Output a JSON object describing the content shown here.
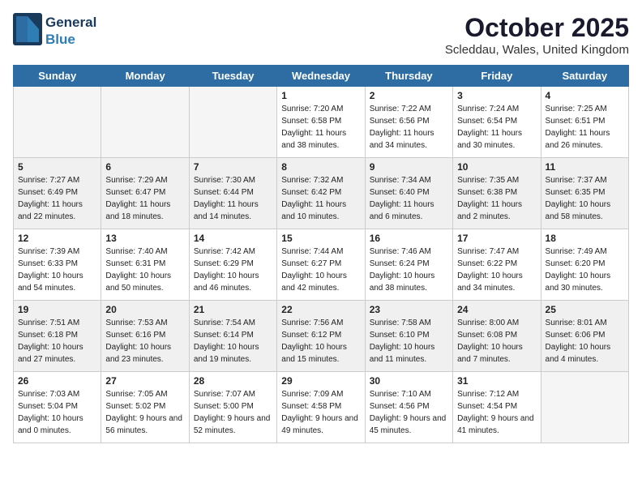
{
  "header": {
    "logo_line1": "General",
    "logo_line2": "Blue",
    "month": "October 2025",
    "location": "Scleddau, Wales, United Kingdom"
  },
  "days_of_week": [
    "Sunday",
    "Monday",
    "Tuesday",
    "Wednesday",
    "Thursday",
    "Friday",
    "Saturday"
  ],
  "weeks": [
    [
      {
        "day": "",
        "empty": true
      },
      {
        "day": "",
        "empty": true
      },
      {
        "day": "",
        "empty": true
      },
      {
        "day": "1",
        "sunrise": "7:20 AM",
        "sunset": "6:58 PM",
        "daylight": "11 hours and 38 minutes."
      },
      {
        "day": "2",
        "sunrise": "7:22 AM",
        "sunset": "6:56 PM",
        "daylight": "11 hours and 34 minutes."
      },
      {
        "day": "3",
        "sunrise": "7:24 AM",
        "sunset": "6:54 PM",
        "daylight": "11 hours and 30 minutes."
      },
      {
        "day": "4",
        "sunrise": "7:25 AM",
        "sunset": "6:51 PM",
        "daylight": "11 hours and 26 minutes."
      }
    ],
    [
      {
        "day": "5",
        "sunrise": "7:27 AM",
        "sunset": "6:49 PM",
        "daylight": "11 hours and 22 minutes."
      },
      {
        "day": "6",
        "sunrise": "7:29 AM",
        "sunset": "6:47 PM",
        "daylight": "11 hours and 18 minutes."
      },
      {
        "day": "7",
        "sunrise": "7:30 AM",
        "sunset": "6:44 PM",
        "daylight": "11 hours and 14 minutes."
      },
      {
        "day": "8",
        "sunrise": "7:32 AM",
        "sunset": "6:42 PM",
        "daylight": "11 hours and 10 minutes."
      },
      {
        "day": "9",
        "sunrise": "7:34 AM",
        "sunset": "6:40 PM",
        "daylight": "11 hours and 6 minutes."
      },
      {
        "day": "10",
        "sunrise": "7:35 AM",
        "sunset": "6:38 PM",
        "daylight": "11 hours and 2 minutes."
      },
      {
        "day": "11",
        "sunrise": "7:37 AM",
        "sunset": "6:35 PM",
        "daylight": "10 hours and 58 minutes."
      }
    ],
    [
      {
        "day": "12",
        "sunrise": "7:39 AM",
        "sunset": "6:33 PM",
        "daylight": "10 hours and 54 minutes."
      },
      {
        "day": "13",
        "sunrise": "7:40 AM",
        "sunset": "6:31 PM",
        "daylight": "10 hours and 50 minutes."
      },
      {
        "day": "14",
        "sunrise": "7:42 AM",
        "sunset": "6:29 PM",
        "daylight": "10 hours and 46 minutes."
      },
      {
        "day": "15",
        "sunrise": "7:44 AM",
        "sunset": "6:27 PM",
        "daylight": "10 hours and 42 minutes."
      },
      {
        "day": "16",
        "sunrise": "7:46 AM",
        "sunset": "6:24 PM",
        "daylight": "10 hours and 38 minutes."
      },
      {
        "day": "17",
        "sunrise": "7:47 AM",
        "sunset": "6:22 PM",
        "daylight": "10 hours and 34 minutes."
      },
      {
        "day": "18",
        "sunrise": "7:49 AM",
        "sunset": "6:20 PM",
        "daylight": "10 hours and 30 minutes."
      }
    ],
    [
      {
        "day": "19",
        "sunrise": "7:51 AM",
        "sunset": "6:18 PM",
        "daylight": "10 hours and 27 minutes."
      },
      {
        "day": "20",
        "sunrise": "7:53 AM",
        "sunset": "6:16 PM",
        "daylight": "10 hours and 23 minutes."
      },
      {
        "day": "21",
        "sunrise": "7:54 AM",
        "sunset": "6:14 PM",
        "daylight": "10 hours and 19 minutes."
      },
      {
        "day": "22",
        "sunrise": "7:56 AM",
        "sunset": "6:12 PM",
        "daylight": "10 hours and 15 minutes."
      },
      {
        "day": "23",
        "sunrise": "7:58 AM",
        "sunset": "6:10 PM",
        "daylight": "10 hours and 11 minutes."
      },
      {
        "day": "24",
        "sunrise": "8:00 AM",
        "sunset": "6:08 PM",
        "daylight": "10 hours and 7 minutes."
      },
      {
        "day": "25",
        "sunrise": "8:01 AM",
        "sunset": "6:06 PM",
        "daylight": "10 hours and 4 minutes."
      }
    ],
    [
      {
        "day": "26",
        "sunrise": "7:03 AM",
        "sunset": "5:04 PM",
        "daylight": "10 hours and 0 minutes."
      },
      {
        "day": "27",
        "sunrise": "7:05 AM",
        "sunset": "5:02 PM",
        "daylight": "9 hours and 56 minutes."
      },
      {
        "day": "28",
        "sunrise": "7:07 AM",
        "sunset": "5:00 PM",
        "daylight": "9 hours and 52 minutes."
      },
      {
        "day": "29",
        "sunrise": "7:09 AM",
        "sunset": "4:58 PM",
        "daylight": "9 hours and 49 minutes."
      },
      {
        "day": "30",
        "sunrise": "7:10 AM",
        "sunset": "4:56 PM",
        "daylight": "9 hours and 45 minutes."
      },
      {
        "day": "31",
        "sunrise": "7:12 AM",
        "sunset": "4:54 PM",
        "daylight": "9 hours and 41 minutes."
      },
      {
        "day": "",
        "empty": true
      }
    ]
  ],
  "labels": {
    "sunrise": "Sunrise:",
    "sunset": "Sunset:",
    "daylight": "Daylight:"
  }
}
